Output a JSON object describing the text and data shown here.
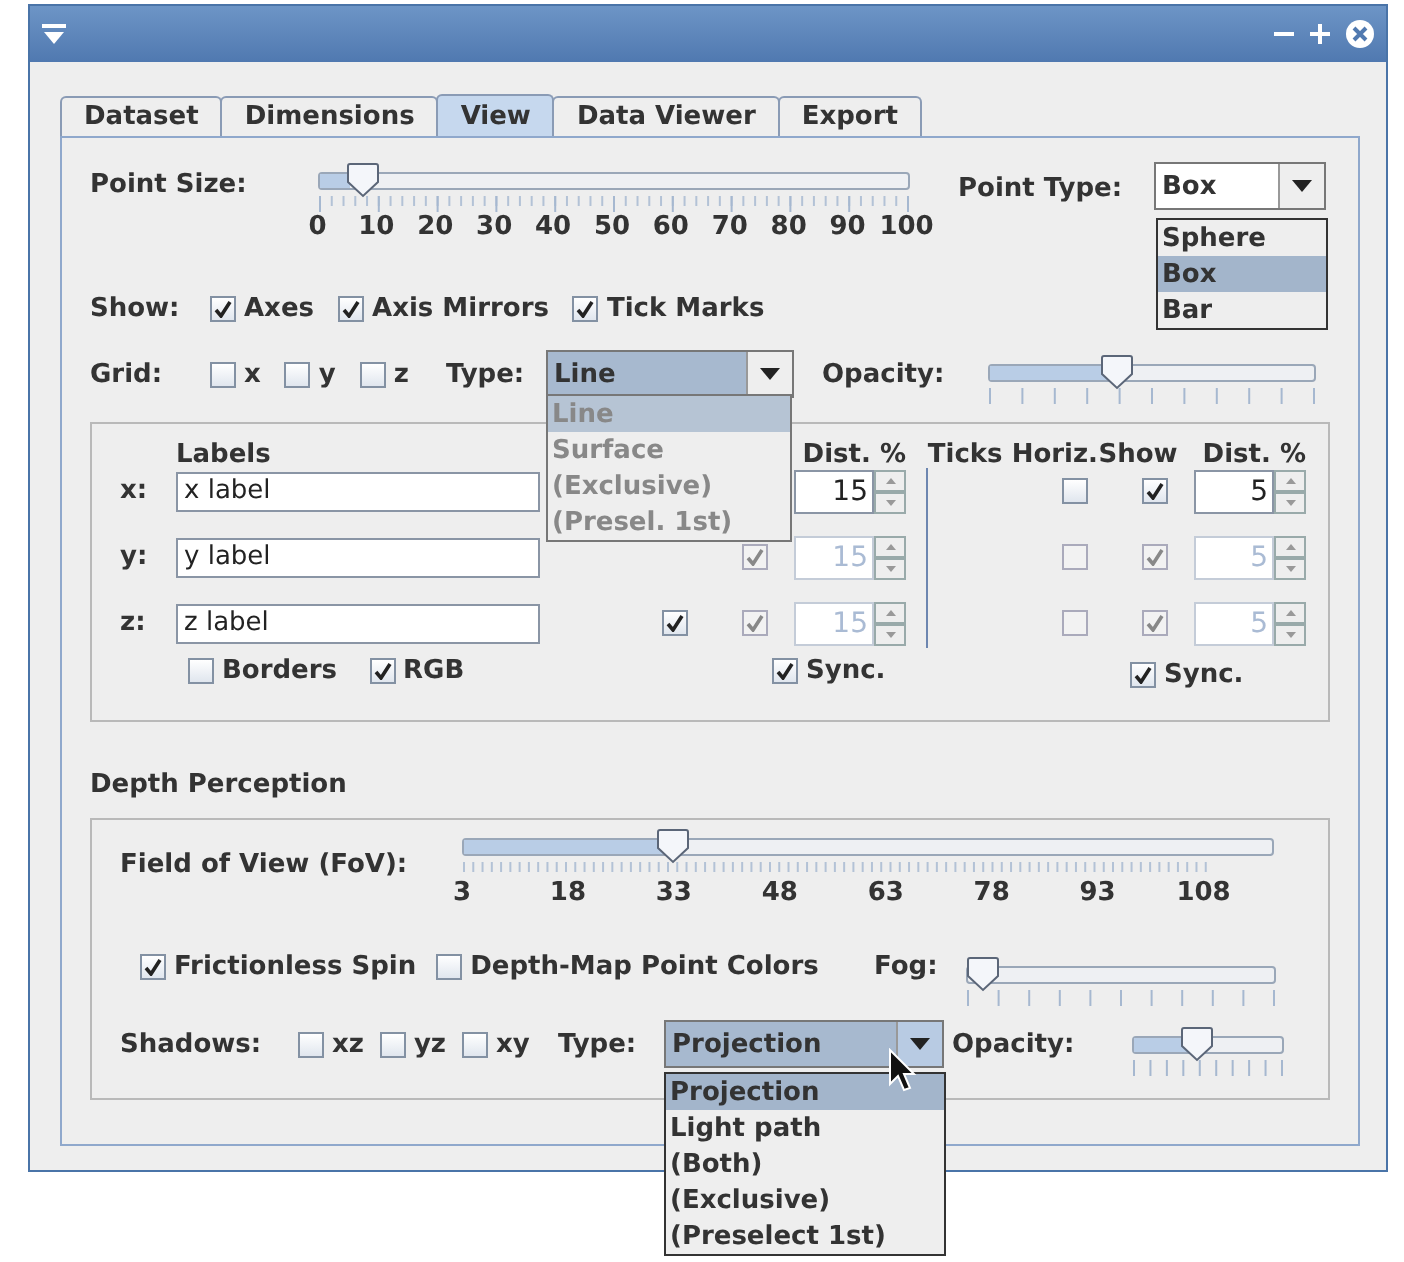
{
  "tabs": [
    {
      "label": "Dataset",
      "selected": false
    },
    {
      "label": "Dimensions",
      "selected": false
    },
    {
      "label": "View",
      "selected": true
    },
    {
      "label": "Data Viewer",
      "selected": false
    },
    {
      "label": "Export",
      "selected": false
    }
  ],
  "point_size": {
    "label": "Point Size:",
    "level": 0.05,
    "tick_labels": [
      "0",
      "10",
      "20",
      "30",
      "40",
      "50",
      "60",
      "70",
      "80",
      "90",
      "100"
    ]
  },
  "point_type": {
    "label": "Point Type:",
    "value": "Box",
    "options": [
      {
        "label": "Sphere",
        "selected": false
      },
      {
        "label": "Box",
        "selected": true
      },
      {
        "label": "Bar",
        "selected": false
      }
    ]
  },
  "show": {
    "label": "Show:",
    "checks": [
      {
        "label": "Axes",
        "checked": true
      },
      {
        "label": "Axis Mirrors",
        "checked": true
      },
      {
        "label": "Tick Marks",
        "checked": true
      }
    ]
  },
  "grid": {
    "label": "Grid:",
    "checks": [
      {
        "label": "x",
        "checked": false
      },
      {
        "label": "y",
        "checked": false
      },
      {
        "label": "z",
        "checked": false
      }
    ],
    "type_label": "Type:",
    "type_value": "Line",
    "type_options": [
      {
        "label": "Line",
        "selected": true
      },
      {
        "label": "Surface",
        "selected": false
      },
      {
        "label": "(Exclusive)",
        "selected": false
      },
      {
        "label": "(Presel. 1st)",
        "selected": false
      }
    ],
    "opacity": {
      "label": "Opacity:",
      "level": 0.38
    }
  },
  "labels_panel": {
    "labels_header": "Labels",
    "left_header": "Dist. %",
    "right_headers": [
      "Ticks Horiz.",
      "Show",
      "Dist. %"
    ],
    "rows": [
      {
        "axis": "x:",
        "text": "x label",
        "left": {
          "distance": "15",
          "disabled": false
        },
        "right": {
          "horiz": false,
          "show": true,
          "distance": "5",
          "disabled": false
        }
      },
      {
        "axis": "y:",
        "text": "y label",
        "left": {
          "show": true,
          "distance": "15",
          "disabled": true
        },
        "right": {
          "horiz": false,
          "show": true,
          "distance": "5",
          "disabled": true
        }
      },
      {
        "axis": "z:",
        "text": "z label",
        "left": {
          "horiz": true,
          "show": true,
          "distance": "15",
          "disabled": true
        },
        "right": {
          "horiz": false,
          "show": true,
          "distance": "5",
          "disabled": true
        }
      }
    ],
    "borders": {
      "label": "Borders",
      "checked": false
    },
    "rgb": {
      "label": "RGB",
      "checked": true
    },
    "left_sync": {
      "label": "Sync.",
      "checked": true
    },
    "right_sync": {
      "label": "Sync.",
      "checked": true
    }
  },
  "depth": {
    "title": "Depth Perception",
    "fov": {
      "label": "Field of View (FoV):",
      "level": 0.25,
      "tick_labels": [
        "3",
        "18",
        "33",
        "48",
        "63",
        "78",
        "93",
        "108"
      ]
    },
    "checks": [
      {
        "label": "Frictionless Spin",
        "checked": true
      },
      {
        "label": "Depth-Map Point Colors",
        "checked": false
      }
    ],
    "fog": {
      "label": "Fog:",
      "level": 0
    },
    "shadows": {
      "label": "Shadows:",
      "checks": [
        {
          "label": "xz",
          "checked": false
        },
        {
          "label": "yz",
          "checked": false
        },
        {
          "label": "xy",
          "checked": false
        }
      ],
      "type_label": "Type:",
      "type_value": "Projection",
      "options": [
        {
          "label": "Projection",
          "selected": true
        },
        {
          "label": "Light path",
          "selected": false
        },
        {
          "label": "(Both)",
          "selected": false
        },
        {
          "label": "(Exclusive)",
          "selected": false
        },
        {
          "label": "(Preselect 1st)",
          "selected": false
        }
      ],
      "opacity": {
        "label": "Opacity:",
        "level": 0.4
      }
    }
  }
}
